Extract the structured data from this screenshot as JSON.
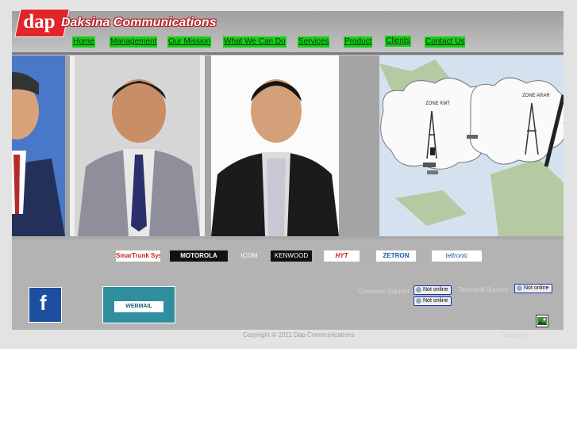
{
  "brand": {
    "logo_text": "dap",
    "name": "Daksina Communications"
  },
  "nav": [
    {
      "label": "Home"
    },
    {
      "label": "Management"
    },
    {
      "label": "Our Mission"
    },
    {
      "label": "What We Can Do"
    },
    {
      "label": "Services"
    },
    {
      "label": "Product"
    },
    {
      "label": "Clients"
    },
    {
      "label": "Contact Us"
    }
  ],
  "map": {
    "zone_left": "ZONE KMT",
    "zone_right": "ZONE ARAR"
  },
  "partners": [
    "SmarTrunk Systems, Inc.",
    "MOTOROLA",
    "ICOM",
    "KENWOOD",
    "HYT",
    "ZETRON",
    "teltronic"
  ],
  "social": {
    "facebook_glyph": "f",
    "webmail_label": "WEBMAIL"
  },
  "support": {
    "customer_label": "Customer Support :",
    "technical_label": "Technical Support :",
    "status_text": "Not online"
  },
  "footer": {
    "copyright": "Copyright © 2011 Dap Communications",
    "design_by": "Design by"
  },
  "colors": {
    "nav_bg": "#12d312",
    "logo_red": "#e0252b",
    "frame_gray": "#a9a9a9"
  }
}
